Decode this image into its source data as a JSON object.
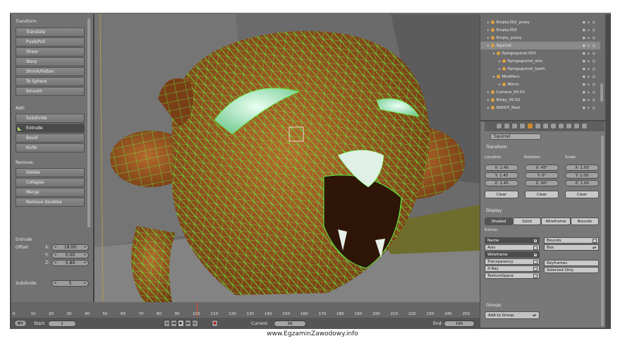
{
  "tool_panel": {
    "sections": {
      "transform": "Transform",
      "add": "Add:",
      "remove": "Remove:",
      "extrude": "Extrude"
    },
    "transform_buttons": [
      "Translate",
      "Push/Pull",
      "Shear",
      "Warp",
      "Shrink/Fatten",
      "To Sphere",
      "Smooth"
    ],
    "add_buttons": [
      "Subdivide",
      "Extrude",
      "Bevel",
      "Knife"
    ],
    "remove_buttons": [
      "Delete",
      "Collapse",
      "Merge",
      "Remove Doubles"
    ],
    "active_button": "Extrude",
    "extrude": {
      "offset_label": "Offset",
      "x_label": "X:",
      "x": "18.00",
      "y_label": "Y:",
      "y": "0.00",
      "z_label": "Z:",
      "z": "5.89",
      "subdivide_label": "Subdivide",
      "subdivide": "5"
    }
  },
  "viewport": {
    "subject": "wireframe squirrel head",
    "colors": {
      "mesh": "#9b5220",
      "wire": "#5ef540",
      "eyes": "#bfeed6",
      "teeth": "#e6f0e8",
      "bg": "#6a6a6a"
    }
  },
  "outliner": {
    "items": [
      {
        "label": "Empty.002_proxy",
        "indent": 0
      },
      {
        "label": "Empty.003",
        "indent": 0
      },
      {
        "label": "Empty_proxy",
        "indent": 0
      },
      {
        "label": "Squirrel",
        "indent": 0,
        "selected": true
      },
      {
        "label": "flyingsquirrel.003",
        "indent": 1
      },
      {
        "label": "flyingsquirrel_skin",
        "indent": 2
      },
      {
        "label": "flyingsquirrel_teeth",
        "indent": 2
      },
      {
        "label": "Modifiers",
        "indent": 1
      },
      {
        "label": "Mirror",
        "indent": 2
      },
      {
        "label": "Camera_05-02",
        "indent": 0
      },
      {
        "label": "Rinky_05-02",
        "indent": 0
      },
      {
        "label": "WIDGT_Root",
        "indent": 0
      }
    ]
  },
  "properties": {
    "object_name": "Squirrel",
    "transform": {
      "title": "Transform",
      "location_label": "Location",
      "rotation_label": "Rotation",
      "scale_label": "Scale",
      "location": [
        "X: 1.45",
        "Y: 1.45",
        "Z: 1.45"
      ],
      "rotation": [
        "X: 45°",
        "Y: 0°",
        "Z: 90°"
      ],
      "scale": [
        "X: 1.00",
        "Y: 1.00",
        "Z: 1.00"
      ],
      "clear_label": "Clear"
    },
    "display": {
      "title": "Display",
      "modes": [
        "Shaded",
        "Solid",
        "Wireframe",
        "Bounds"
      ],
      "active_mode": "Shaded",
      "extras_label": "Extras:",
      "left_options": [
        {
          "label": "Name",
          "checked": true
        },
        {
          "label": "Axis",
          "checked": false
        },
        {
          "label": "Wireframe",
          "checked": true
        },
        {
          "label": "Transparency",
          "checked": false
        },
        {
          "label": "X-Ray",
          "checked": false
        },
        {
          "label": "TextureSpace",
          "checked": false
        }
      ],
      "bounds_label": "Bounds",
      "box_label": "Box",
      "keyframes_label": "Keyframes",
      "selected_only_label": "Selected Only"
    },
    "groups": {
      "title": "Groups",
      "add_to_group": "Add to Group"
    }
  },
  "timeline": {
    "ticks": [
      "0",
      "10",
      "20",
      "30",
      "40",
      "50",
      "60",
      "70",
      "80",
      "90",
      "100",
      "110",
      "120",
      "130",
      "140",
      "150",
      "160",
      "170",
      "180",
      "190",
      "200",
      "210",
      "220",
      "230",
      "240",
      "250"
    ],
    "start_label": "Start:",
    "start": "1",
    "current_label": "Current:",
    "current": "99",
    "end_label": "End:",
    "end": "166"
  },
  "watermark": "www.EgzaminZawodowy.info"
}
